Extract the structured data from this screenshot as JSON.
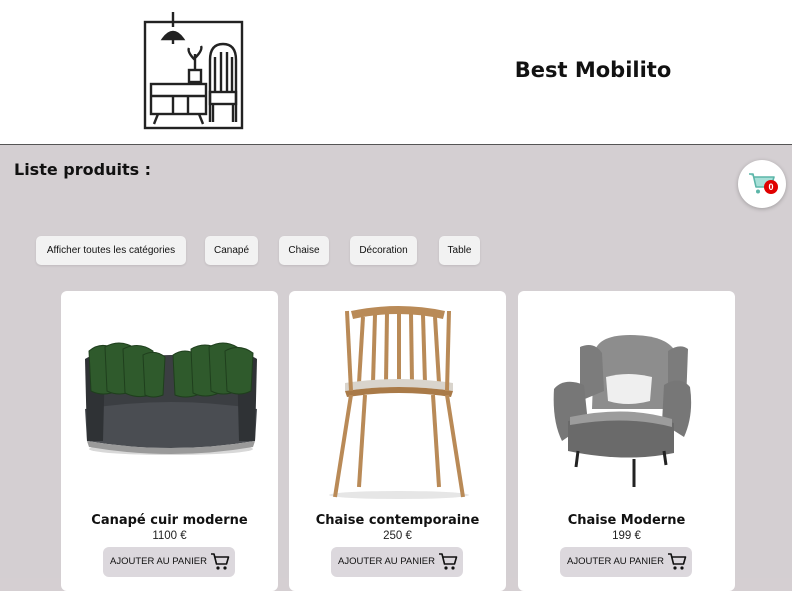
{
  "header": {
    "brand": "Best Mobilito"
  },
  "main": {
    "title": "Liste produits :",
    "cart": {
      "count": "0"
    },
    "filters": [
      "Afficher toutes les catégories",
      "Canapé",
      "Chaise",
      "Décoration",
      "Table"
    ],
    "products": [
      {
        "name": "Canapé cuir moderne",
        "price": "1100 €",
        "button": "AJOUTER AU PANIER"
      },
      {
        "name": "Chaise contemporaine",
        "price": "250 €",
        "button": "AJOUTER AU PANIER"
      },
      {
        "name": "Chaise Moderne",
        "price": "199 €",
        "button": "AJOUTER AU PANIER"
      }
    ]
  },
  "icons": {
    "logo": "furniture-logo-icon",
    "cart": "shopping-cart-icon",
    "add_to_cart": "cart-outline-icon"
  },
  "colors": {
    "page_background": "#d4cfd2",
    "cart_icon": "#7fcfc4",
    "badge": "#e00000"
  }
}
